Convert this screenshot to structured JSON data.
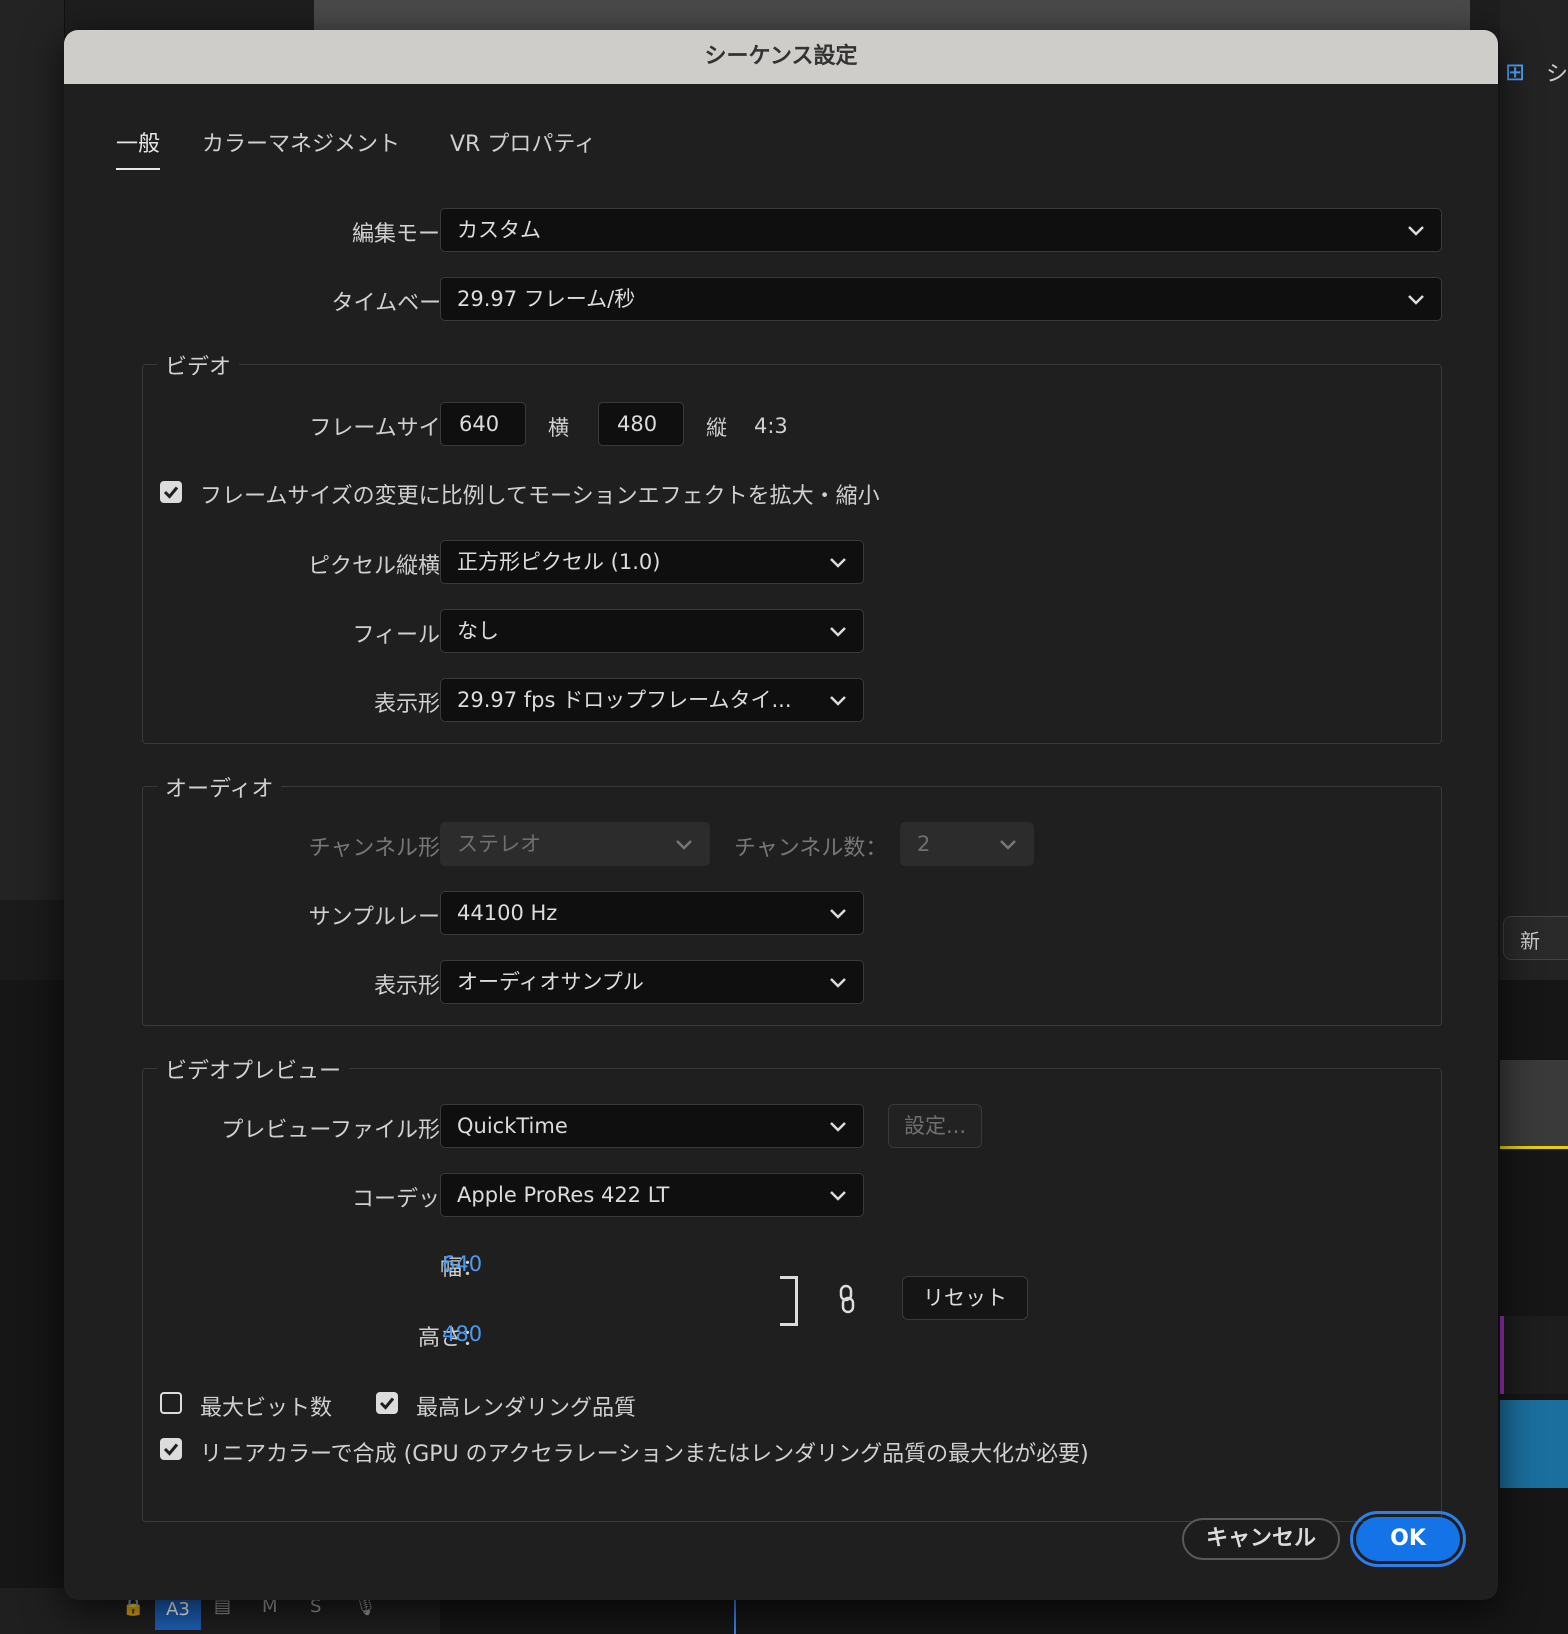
{
  "background": {
    "right_panel_label": "シ",
    "right_panel_button": "新",
    "track": {
      "lock": "🔒",
      "name": "A3",
      "mute": "M",
      "solo": "S"
    }
  },
  "dialog": {
    "title": "シーケンス設定",
    "tabs": [
      "一般",
      "カラーマネジメント",
      "VR プロパティ"
    ],
    "active_tab": "一般",
    "edit_mode": {
      "label": "編集モード：",
      "value": "カスタム"
    },
    "timebase": {
      "label": "タイムベース：",
      "value": "29.97  フレーム/秒"
    },
    "video": {
      "legend": "ビデオ",
      "frame_size_label": "フレームサイズ：",
      "width": "640",
      "width_unit": "横",
      "height": "480",
      "height_unit": "縦",
      "aspect": "4:3",
      "scale_checkbox_label": "フレームサイズの変更に比例してモーションエフェクトを拡大・縮小",
      "scale_checked": true,
      "pixel_aspect": {
        "label": "ピクセル縦横比：",
        "value": "正方形ピクセル (1.0)"
      },
      "fields": {
        "label": "フィールド：",
        "value": "なし"
      },
      "display_format": {
        "label": "表示形式：",
        "value": "29.97 fps ドロップフレームタイ..."
      }
    },
    "audio": {
      "legend": "オーディオ",
      "channel_format": {
        "label": "チャンネル形式：",
        "value": "ステレオ"
      },
      "channel_count": {
        "label": "チャンネル数：",
        "value": "2"
      },
      "sample_rate": {
        "label": "サンプルレート：",
        "value": "44100 Hz"
      },
      "display_format": {
        "label": "表示形式：",
        "value": "オーディオサンプル"
      }
    },
    "video_preview": {
      "legend": "ビデオプレビュー",
      "file_format": {
        "label": "プレビューファイル形式：",
        "value": "QuickTime"
      },
      "settings_button": "設定...",
      "codec": {
        "label": "コーデック：",
        "value": "Apple ProRes 422 LT"
      },
      "width_label": "幅：",
      "width_value": "640",
      "height_label": "高さ：",
      "height_value": "480",
      "reset_button": "リセット",
      "max_bit_depth": {
        "label": "最大ビット数",
        "checked": false
      },
      "max_render_quality": {
        "label": "最高レンダリング品質",
        "checked": true
      },
      "linear_color": {
        "label": "リニアカラーで合成 (GPU のアクセラレーションまたはレンダリング品質の最大化が必要)",
        "checked": true
      }
    },
    "cancel_button": "キャンセル",
    "ok_button": "OK"
  },
  "colors": {
    "accent": "#1473e6",
    "link_value": "#4a9bf0",
    "titlebar": "#cfcdca",
    "dialog_bg": "#1f1f1f"
  }
}
